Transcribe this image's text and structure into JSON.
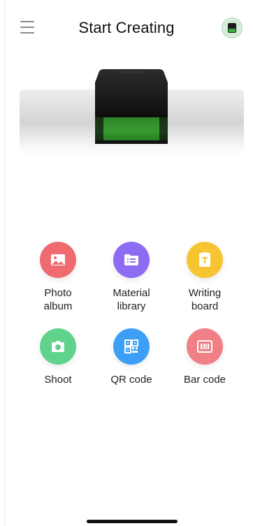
{
  "header": {
    "title": "Start Creating"
  },
  "features": [
    {
      "label": "Photo\nalbum",
      "icon": "image-icon",
      "color": "#ef6b6f"
    },
    {
      "label": "Material\nlibrary",
      "icon": "folder-list-icon",
      "color": "#8c6cf2"
    },
    {
      "label": "Writing\nboard",
      "icon": "text-board-icon",
      "color": "#f6c531"
    },
    {
      "label": "Shoot",
      "icon": "camera-icon",
      "color": "#5fd38c"
    },
    {
      "label": "QR code",
      "icon": "qr-code-icon",
      "color": "#3d9ef5"
    },
    {
      "label": "Bar code",
      "icon": "barcode-icon",
      "color": "#f07f86"
    }
  ]
}
